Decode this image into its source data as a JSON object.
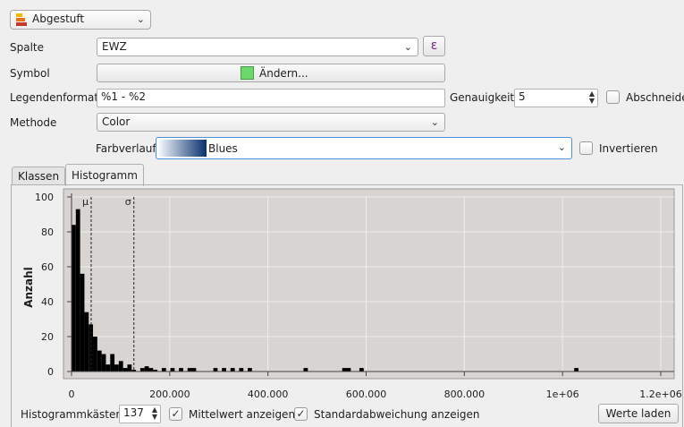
{
  "renderer": {
    "label": "Abgestuft"
  },
  "column": {
    "label": "Spalte",
    "value": "EWZ",
    "expr_glyph": "ε"
  },
  "symbol": {
    "label": "Symbol",
    "button_label": "Ändern...",
    "color": "#6cd86c"
  },
  "legend_format": {
    "label": "Legendenformat",
    "value": "%1 - %2"
  },
  "precision": {
    "label": "Genauigkeit",
    "value": "5"
  },
  "trim": {
    "label": "Abschneiden",
    "checked": false
  },
  "method": {
    "label": "Methode",
    "value": "Color"
  },
  "color_ramp": {
    "label": "Farbverlauf",
    "name": "Blues",
    "start_color": "#f7fbff",
    "end_color": "#08306b"
  },
  "invert": {
    "label": "Invertieren",
    "checked": false
  },
  "tabs": [
    {
      "label": "Klassen",
      "active": false
    },
    {
      "label": "Histogramm",
      "active": true
    }
  ],
  "histogram_controls": {
    "bins_label": "Histogrammkästen",
    "bins_value": "137",
    "show_mean_label": "Mittelwert anzeigen",
    "show_mean": true,
    "show_std_label": "Standardabweichung anzeigen",
    "show_std": true,
    "load_values_label": "Werte laden"
  },
  "chart_data": {
    "type": "bar",
    "ylabel": "Anzahl",
    "xlim": [
      0,
      1200000
    ],
    "ylim": [
      0,
      100
    ],
    "x_ticks": [
      {
        "value": 0,
        "label": "0"
      },
      {
        "value": 200000,
        "label": "200.000"
      },
      {
        "value": 400000,
        "label": "400.000"
      },
      {
        "value": 600000,
        "label": "600.000"
      },
      {
        "value": 800000,
        "label": "800.000"
      },
      {
        "value": 1000000,
        "label": "1e+06"
      },
      {
        "value": 1200000,
        "label": "1.2e+06"
      }
    ],
    "y_ticks": [
      0,
      20,
      40,
      60,
      80,
      100
    ],
    "grid": true,
    "bin_width": 8750,
    "bins": [
      {
        "x": 0,
        "count": 84
      },
      {
        "x": 8750,
        "count": 93
      },
      {
        "x": 17500,
        "count": 56
      },
      {
        "x": 26250,
        "count": 34
      },
      {
        "x": 35000,
        "count": 27
      },
      {
        "x": 43750,
        "count": 20
      },
      {
        "x": 52500,
        "count": 12
      },
      {
        "x": 61250,
        "count": 10
      },
      {
        "x": 70000,
        "count": 4
      },
      {
        "x": 78750,
        "count": 10
      },
      {
        "x": 87500,
        "count": 4
      },
      {
        "x": 96250,
        "count": 6
      },
      {
        "x": 105000,
        "count": 2
      },
      {
        "x": 113750,
        "count": 4
      },
      {
        "x": 122500,
        "count": 1
      },
      {
        "x": 140000,
        "count": 2
      },
      {
        "x": 148750,
        "count": 3
      },
      {
        "x": 157500,
        "count": 2
      },
      {
        "x": 166250,
        "count": 1
      },
      {
        "x": 183750,
        "count": 2
      },
      {
        "x": 201250,
        "count": 2
      },
      {
        "x": 218750,
        "count": 2
      },
      {
        "x": 236250,
        "count": 2
      },
      {
        "x": 245000,
        "count": 2
      },
      {
        "x": 288750,
        "count": 2
      },
      {
        "x": 306250,
        "count": 2
      },
      {
        "x": 323750,
        "count": 2
      },
      {
        "x": 341250,
        "count": 2
      },
      {
        "x": 358750,
        "count": 2
      },
      {
        "x": 472500,
        "count": 2
      },
      {
        "x": 551250,
        "count": 2
      },
      {
        "x": 560000,
        "count": 2
      },
      {
        "x": 586250,
        "count": 2
      },
      {
        "x": 1023750,
        "count": 2
      }
    ],
    "annotations": [
      {
        "symbol": "μ",
        "x": 40000
      },
      {
        "symbol": "σ",
        "x": 127000
      }
    ]
  }
}
